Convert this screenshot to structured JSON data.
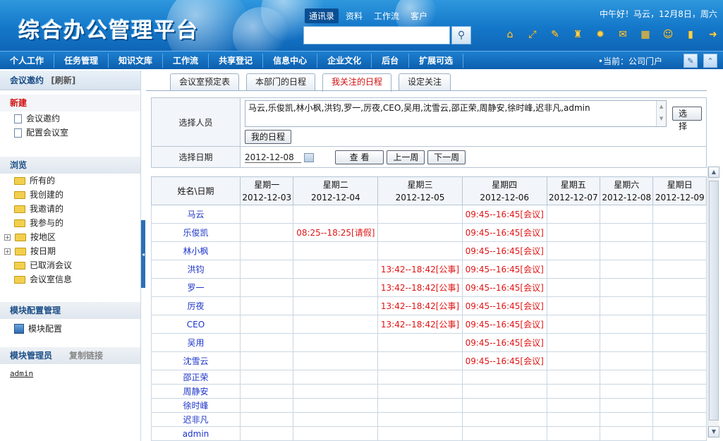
{
  "header": {
    "logo": "综合办公管理平台",
    "top_tabs": [
      "通讯录",
      "资料",
      "工作流",
      "客户"
    ],
    "greeting": "中午好！马云，12月8日，周六",
    "search_placeholder": ""
  },
  "nav": {
    "items": [
      "个人工作",
      "任务管理",
      "知识文库",
      "工作流",
      "共享登记",
      "信息中心",
      "企业文化",
      "后台",
      "扩展可选"
    ],
    "current": "•当前：公司门户"
  },
  "sidebar": {
    "title": "会议邀约",
    "refresh": "[刷新]",
    "new_title": "新建",
    "new_items": [
      "会议邀约",
      "配置会议室"
    ],
    "browse_title": "浏览",
    "browse_items": [
      "所有的",
      "我创建的",
      "我邀请的",
      "我参与的",
      "按地区",
      "按日期",
      "已取消会议",
      "会议室信息"
    ],
    "module_config_title": "模块配置管理",
    "module_config_item": "模块配置",
    "module_admin_title": "模块管理员",
    "copy_link": "复制链接",
    "admin": "admin"
  },
  "tabs": [
    "会议室预定表",
    "本部门的日程",
    "我关注的日程",
    "设定关注"
  ],
  "form": {
    "select_person_label": "选择人员",
    "people": "马云,乐俊凯,林小枫,洪钧,罗一,厉夜,CEO,吴用,沈雪云,邵正荣,周静安,徐时峰,迟非凡,admin",
    "select_btn": "选择",
    "my_schedule_btn": "我的日程",
    "select_date_label": "选择日期",
    "date": "2012-12-08",
    "view_btn": "查 看",
    "prev_week_btn": "上一周",
    "next_week_btn": "下一周"
  },
  "schedule": {
    "corner": "姓名\\日期",
    "days": [
      {
        "weekday": "星期一",
        "date": "2012-12-03"
      },
      {
        "weekday": "星期二",
        "date": "2012-12-04"
      },
      {
        "weekday": "星期三",
        "date": "2012-12-05"
      },
      {
        "weekday": "星期四",
        "date": "2012-12-06"
      },
      {
        "weekday": "星期五",
        "date": "2012-12-07"
      },
      {
        "weekday": "星期六",
        "date": "2012-12-08"
      },
      {
        "weekday": "星期日",
        "date": "2012-12-09"
      }
    ],
    "rows": [
      {
        "name": "马云",
        "cells": [
          "",
          "",
          "",
          "09:45--16:45[会议]",
          "",
          "",
          ""
        ]
      },
      {
        "name": "乐俊凯",
        "cells": [
          "",
          "08:25--18:25[请假]",
          "",
          "09:45--16:45[会议]",
          "",
          "",
          ""
        ]
      },
      {
        "name": "林小枫",
        "cells": [
          "",
          "",
          "",
          "09:45--16:45[会议]",
          "",
          "",
          ""
        ]
      },
      {
        "name": "洪钧",
        "cells": [
          "",
          "",
          "13:42--18:42[公事]",
          "09:45--16:45[会议]",
          "",
          "",
          ""
        ]
      },
      {
        "name": "罗一",
        "cells": [
          "",
          "",
          "13:42--18:42[公事]",
          "09:45--16:45[会议]",
          "",
          "",
          ""
        ]
      },
      {
        "name": "厉夜",
        "cells": [
          "",
          "",
          "13:42--18:42[公事]",
          "09:45--16:45[会议]",
          "",
          "",
          ""
        ]
      },
      {
        "name": "CEO",
        "cells": [
          "",
          "",
          "13:42--18:42[公事]",
          "09:45--16:45[会议]",
          "",
          "",
          ""
        ]
      },
      {
        "name": "吴用",
        "cells": [
          "",
          "",
          "",
          "09:45--16:45[会议]",
          "",
          "",
          ""
        ]
      },
      {
        "name": "沈雪云",
        "cells": [
          "",
          "",
          "",
          "09:45--16:45[会议]",
          "",
          "",
          ""
        ]
      },
      {
        "name": "邵正荣",
        "cells": [
          "",
          "",
          "",
          "",
          "",
          "",
          ""
        ]
      },
      {
        "name": "周静安",
        "cells": [
          "",
          "",
          "",
          "",
          "",
          "",
          ""
        ]
      },
      {
        "name": "徐时峰",
        "cells": [
          "",
          "",
          "",
          "",
          "",
          "",
          ""
        ]
      },
      {
        "name": "迟非凡",
        "cells": [
          "",
          "",
          "",
          "",
          "",
          "",
          ""
        ]
      },
      {
        "name": "admin",
        "cells": [
          "",
          "",
          "",
          "",
          "",
          "",
          ""
        ]
      }
    ]
  },
  "colors": {
    "accent": "#1477c9",
    "event": "#e01414",
    "name_link": "#1d35c9"
  }
}
